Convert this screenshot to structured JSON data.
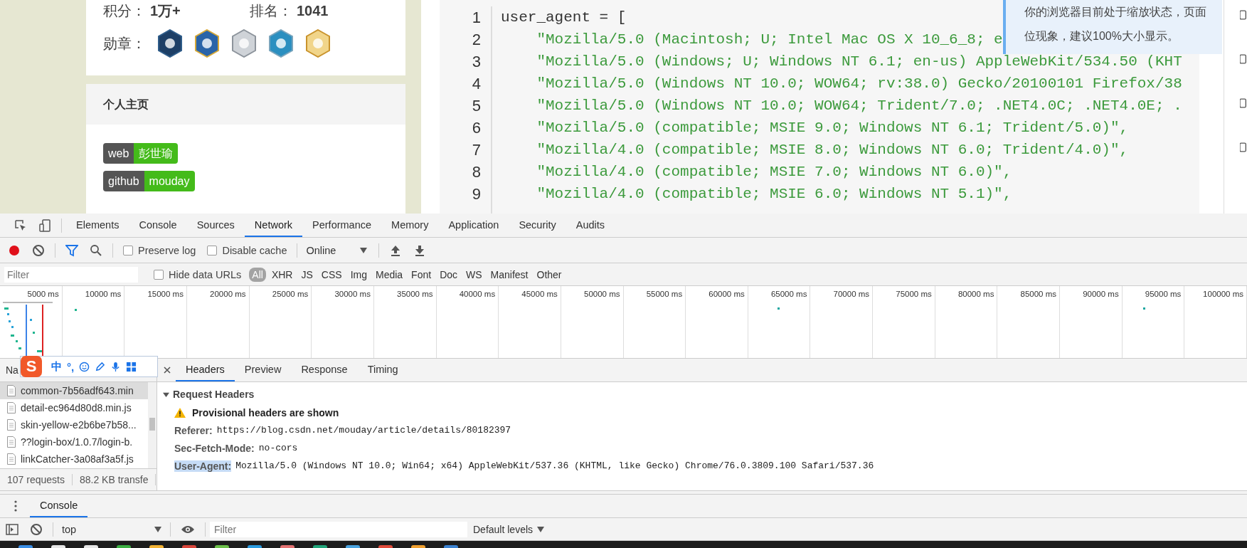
{
  "profile": {
    "points_label": "积分：",
    "points": "1万+",
    "rank_label": "排名：",
    "rank": "1041",
    "medals_label": "勋章："
  },
  "homepage": {
    "title": "个人主页",
    "links": [
      {
        "label": "web",
        "value": "彭世瑜"
      },
      {
        "label": "github",
        "value": "mouday"
      }
    ]
  },
  "code": {
    "lines": [
      {
        "number": "1",
        "kind": "plain",
        "text": "user_agent = ["
      },
      {
        "number": "2",
        "kind": "string",
        "text": "    \"Mozilla/5.0 (Macintosh; U; Intel Mac OS X 10_6_8; e"
      },
      {
        "number": "3",
        "kind": "string",
        "text": "    \"Mozilla/5.0 (Windows; U; Windows NT 6.1; en-us) AppleWebKit/534.50 (KHT"
      },
      {
        "number": "4",
        "kind": "string",
        "text": "    \"Mozilla/5.0 (Windows NT 10.0; WOW64; rv:38.0) Gecko/20100101 Firefox/38"
      },
      {
        "number": "5",
        "kind": "string",
        "text": "    \"Mozilla/5.0 (Windows NT 10.0; WOW64; Trident/7.0; .NET4.0C; .NET4.0E; ."
      },
      {
        "number": "6",
        "kind": "string",
        "text": "    \"Mozilla/5.0 (compatible; MSIE 9.0; Windows NT 6.1; Trident/5.0)\","
      },
      {
        "number": "7",
        "kind": "string",
        "text": "    \"Mozilla/4.0 (compatible; MSIE 8.0; Windows NT 6.0; Trident/4.0)\","
      },
      {
        "number": "8",
        "kind": "string",
        "text": "    \"Mozilla/4.0 (compatible; MSIE 7.0; Windows NT 6.0)\","
      },
      {
        "number": "9",
        "kind": "string",
        "text": "    \"Mozilla/4.0 (compatible; MSIE 6.0; Windows NT 5.1)\","
      }
    ]
  },
  "notice": {
    "lines": [
      "你的浏览器目前处于缩放状态，页面",
      "位现象，建议100%大小显示。"
    ]
  },
  "devtools": {
    "tabs": [
      {
        "label": "Elements",
        "selected": false
      },
      {
        "label": "Console",
        "selected": false
      },
      {
        "label": "Sources",
        "selected": false
      },
      {
        "label": "Network",
        "selected": true
      },
      {
        "label": "Performance",
        "selected": false
      },
      {
        "label": "Memory",
        "selected": false
      },
      {
        "label": "Application",
        "selected": false
      },
      {
        "label": "Security",
        "selected": false
      },
      {
        "label": "Audits",
        "selected": false
      }
    ],
    "toolbar": {
      "recording": true,
      "filter_active": true,
      "options": [
        {
          "label": "Preserve log",
          "checked": false
        },
        {
          "label": "Disable cache",
          "checked": false
        }
      ],
      "throttling": "Online"
    },
    "filter_bar": {
      "placeholder": "Filter",
      "hide_data_urls": {
        "label": "Hide data URLs",
        "checked": false
      },
      "types": [
        {
          "label": "All",
          "selected": true
        },
        {
          "label": "XHR",
          "selected": false
        },
        {
          "label": "JS",
          "selected": false
        },
        {
          "label": "CSS",
          "selected": false
        },
        {
          "label": "Img",
          "selected": false
        },
        {
          "label": "Media",
          "selected": false
        },
        {
          "label": "Font",
          "selected": false
        },
        {
          "label": "Doc",
          "selected": false
        },
        {
          "label": "WS",
          "selected": false
        },
        {
          "label": "Manifest",
          "selected": false
        },
        {
          "label": "Other",
          "selected": false
        }
      ]
    },
    "timeline": {
      "ticks": [
        "5000 ms",
        "10000 ms",
        "15000 ms",
        "20000 ms",
        "25000 ms",
        "30000 ms",
        "35000 ms",
        "40000 ms",
        "45000 ms",
        "50000 ms",
        "55000 ms",
        "60000 ms",
        "65000 ms",
        "70000 ms",
        "75000 ms",
        "80000 ms",
        "85000 ms",
        "90000 ms",
        "95000 ms",
        "100000 ms"
      ]
    },
    "requests": {
      "header": "Na",
      "rows": [
        {
          "name": "common-7b56adf643.min",
          "selected": true
        },
        {
          "name": "detail-ec964d80d8.min.js",
          "selected": false
        },
        {
          "name": "skin-yellow-e2b6be7b58...",
          "selected": false
        },
        {
          "name": "??login-box/1.0.7/login-b.",
          "selected": false
        },
        {
          "name": "linkCatcher-3a08af3a5f.js",
          "selected": false
        }
      ],
      "summary": [
        "107 requests",
        "88.2 KB transfe"
      ]
    },
    "ime_toolbar": {
      "logo": "S",
      "items": [
        "中",
        "°,"
      ]
    },
    "details": {
      "tabs": [
        {
          "label": "Headers",
          "selected": true
        },
        {
          "label": "Preview",
          "selected": false
        },
        {
          "label": "Response",
          "selected": false
        },
        {
          "label": "Timing",
          "selected": false
        }
      ],
      "section": {
        "title": "Request Headers",
        "expanded": true,
        "warning": "Provisional headers are shown",
        "headers": [
          {
            "name": "Referer:",
            "value": "https://blog.csdn.net/mouday/article/details/80182397",
            "highlighted": false
          },
          {
            "name": "Sec-Fetch-Mode:",
            "value": "no-cors",
            "highlighted": false
          },
          {
            "name": "User-Agent:",
            "value": "Mozilla/5.0 (Windows NT 10.0; Win64; x64) AppleWebKit/537.36 (KHTML, like Gecko) Chrome/76.0.3809.100 Safari/537.36",
            "highlighted": true
          }
        ]
      }
    },
    "drawer": {
      "tabs": [
        {
          "label": "Console",
          "selected": true
        }
      ],
      "context": "top",
      "filter_placeholder": "Filter",
      "levels": "Default levels"
    }
  }
}
